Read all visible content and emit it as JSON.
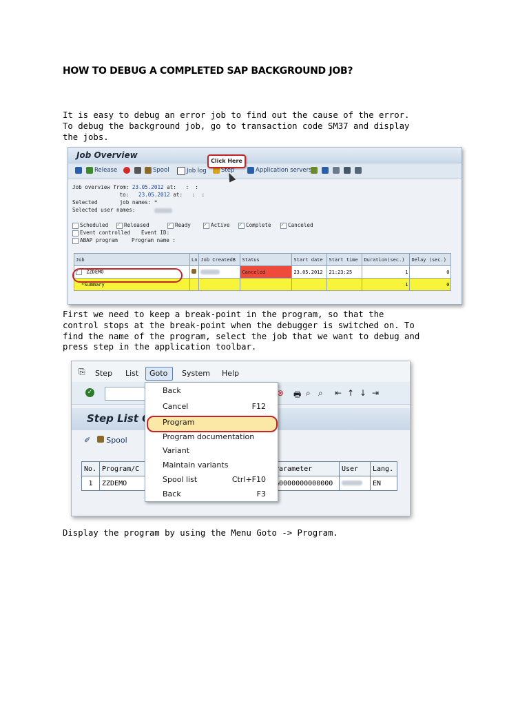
{
  "title": "HOW TO DEBUG A COMPLETED SAP BACKGROUND JOB?",
  "paragraphs": {
    "p1": "It is easy to debug an error job to find out the cause of the error.\nTo debug the background job, go to transaction code SM37 and display\nthe jobs.",
    "p2": "First we need to keep a break-point in the program, so that the\ncontrol stops at the break-point when the debugger is switched on. To\nfind the name of the program, select the job that we want to debug and\npress step in the application toolbar.",
    "p3": "Display the program by using the Menu Goto -> Program."
  },
  "shot1": {
    "title": "Job Overview",
    "callout": "Click Here",
    "toolbar": {
      "release": "Release",
      "spool": "Spool",
      "job_log": "Job log",
      "step": "Step",
      "app_servers": "Application servers"
    },
    "info": {
      "line1_label": "Job overview from:",
      "line1_date": "23.05.2012",
      "line1_at": "at:",
      "line1_time": ":  :",
      "line2_label": "to:",
      "line2_date": "23.05.2012",
      "line2_at": "at:",
      "line2_time": ":  :",
      "line3_label": "Selected       job names:",
      "line3_val": "*",
      "line4_label": "Selected user names:"
    },
    "checks": {
      "scheduled": "Scheduled",
      "released": "Released",
      "ready": "Ready",
      "active": "Active",
      "complete": "Complete",
      "canceled": "Canceled",
      "event_controlled": "Event controlled",
      "event_id": "Event ID:",
      "abap_program": "ABAP program",
      "program_name": "Program name :"
    },
    "table": {
      "headers": [
        "Job",
        "Ln",
        "Job CreatedB",
        "Status",
        "Start date",
        "Start time",
        "Duration(sec.)",
        "Delay (sec.)"
      ],
      "row": {
        "job": "ZZDEMO",
        "status": "Canceled",
        "start_date": "23.05.2012",
        "start_time": "21:23:25",
        "duration": "1",
        "delay": "0"
      },
      "summary": {
        "label": "*Summary",
        "duration": "1",
        "delay": "0"
      }
    }
  },
  "shot2": {
    "menubar": [
      "Step",
      "List",
      "Goto",
      "System",
      "Help"
    ],
    "title": "Step List O",
    "spool": "Spool",
    "menu": [
      {
        "label": "Back",
        "shortcut": ""
      },
      {
        "label": "Cancel",
        "shortcut": "F12"
      },
      {
        "label": "Program",
        "shortcut": ""
      },
      {
        "label": "Program documentation",
        "shortcut": ""
      },
      {
        "label": "Variant",
        "shortcut": ""
      },
      {
        "label": "Maintain variants",
        "shortcut": ""
      },
      {
        "label": "Spool list",
        "shortcut": "Ctrl+F10"
      },
      {
        "label": "Back",
        "shortcut": "F3"
      }
    ],
    "table": {
      "headers": [
        "No.",
        "Program/C",
        "Parameter",
        "User",
        "Lang."
      ],
      "row": {
        "no": "1",
        "program": "ZZDEMO",
        "parameter": "&0000000000000",
        "lang": "EN"
      }
    }
  }
}
